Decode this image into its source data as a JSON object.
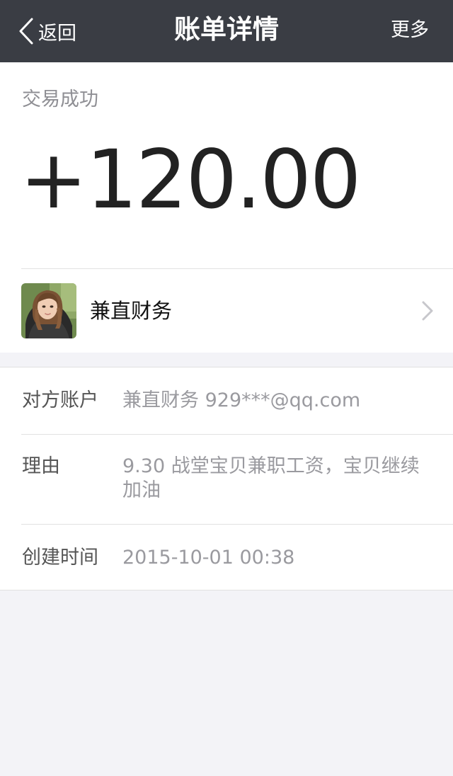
{
  "nav": {
    "back_label": "返回",
    "title": "账单详情",
    "more_label": "更多"
  },
  "transaction": {
    "status": "交易成功",
    "amount": "+120.00"
  },
  "payer": {
    "name": "兼直财务"
  },
  "details": {
    "account_label": "对方账户",
    "account_value": "兼直财务 929***@qq.com",
    "reason_label": "理由",
    "reason_value": "9.30 战堂宝贝兼职工资，宝贝继续加油",
    "created_label": "创建时间",
    "created_value": "2015-10-01 00:38"
  },
  "colors": {
    "navbar_bg": "#3a3d44",
    "page_bg": "#f3f3f7",
    "amount_text": "#222222",
    "muted_text": "#9a9a9f"
  }
}
